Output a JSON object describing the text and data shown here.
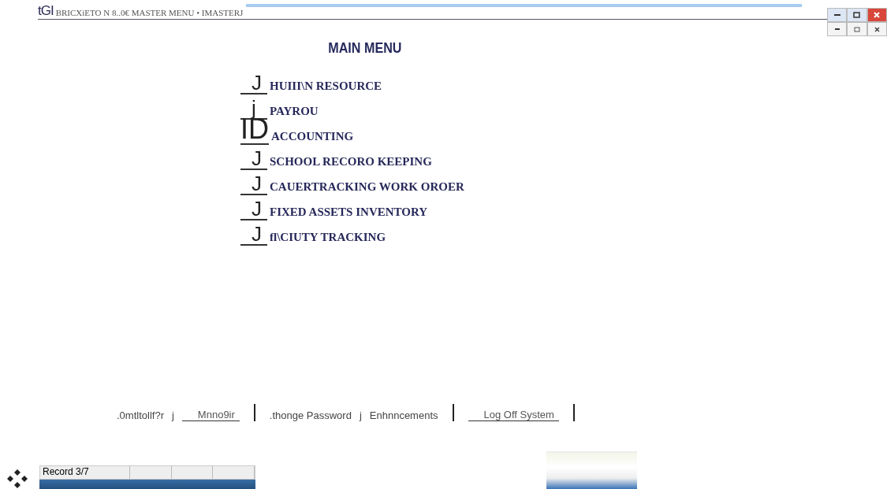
{
  "window": {
    "logo": "tGI",
    "title": "BRICXiETO N 8..0€ MASTER MENU • IMASTERJ"
  },
  "main_title": "MAIN MENU",
  "menu_items": [
    {
      "marker": "J",
      "label": "HUIII\\N RESOURCE"
    },
    {
      "marker": "j",
      "label": "PAYROU"
    },
    {
      "marker": "ID",
      "label": "ACCOUNTING"
    },
    {
      "marker": "J",
      "label": "SCHOOL RECORO KEEPING"
    },
    {
      "marker": "J",
      "label": "CAUERTRACKING WORK OROER"
    },
    {
      "marker": "J",
      "label": "FIXED ASSETS INVENTORY"
    },
    {
      "marker": "J",
      "label": "fl\\CIUTY TRACKING"
    }
  ],
  "bottom_bar": [
    {
      "kind": "text",
      "label": ".0mtltollf?r"
    },
    {
      "kind": "text",
      "label": "j"
    },
    {
      "kind": "link",
      "label": "Mnno9ir"
    },
    {
      "kind": "divider"
    },
    {
      "kind": "text",
      "label": ".thonge Password"
    },
    {
      "kind": "text",
      "label": "j"
    },
    {
      "kind": "text",
      "label": "Enhnncements"
    },
    {
      "kind": "divider"
    },
    {
      "kind": "link",
      "label": "Log Off System"
    },
    {
      "kind": "divider"
    }
  ],
  "status_bar": {
    "record": "Record 3/7"
  }
}
